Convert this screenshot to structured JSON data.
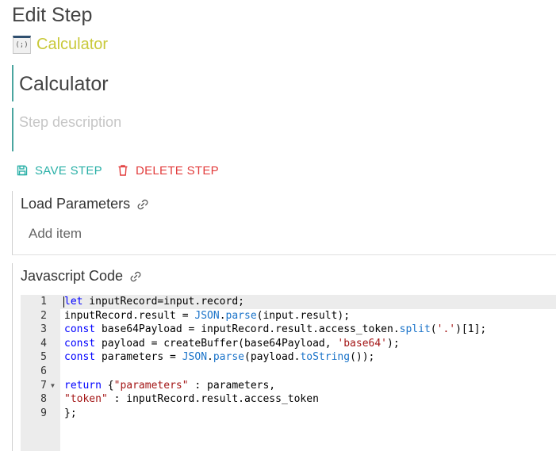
{
  "page": {
    "title": "Edit Step"
  },
  "step_type": {
    "icon": "calculator-icon",
    "icon_text": "(;)",
    "name": "Calculator",
    "color": "#c9c93a"
  },
  "step": {
    "name": "Calculator",
    "description_placeholder": "Step description"
  },
  "actions": {
    "save_label": "SAVE STEP",
    "save_icon": "save-icon",
    "save_color": "#2ab0a7",
    "delete_label": "DELETE STEP",
    "delete_icon": "trash-icon",
    "delete_color": "#e23c3c"
  },
  "load_parameters": {
    "title": "Load Parameters",
    "icon": "link-icon",
    "add_item_label": "Add item"
  },
  "javascript_code": {
    "title": "Javascript Code",
    "icon": "link-icon",
    "lines": [
      {
        "num": "1",
        "code": "let inputRecord=input.record;"
      },
      {
        "num": "2",
        "code": "inputRecord.result = JSON.parse(input.result);"
      },
      {
        "num": "3",
        "code": "const base64Payload = inputRecord.result.access_token.split('.')[1];"
      },
      {
        "num": "4",
        "code": "const payload = createBuffer(base64Payload, 'base64');"
      },
      {
        "num": "5",
        "code": "const parameters = JSON.parse(payload.toString());"
      },
      {
        "num": "6",
        "code": ""
      },
      {
        "num": "7",
        "code": "return {\"parameters\" : parameters,"
      },
      {
        "num": "8",
        "code": "\"token\" : inputRecord.result.access_token"
      },
      {
        "num": "9",
        "code": "};"
      }
    ]
  }
}
